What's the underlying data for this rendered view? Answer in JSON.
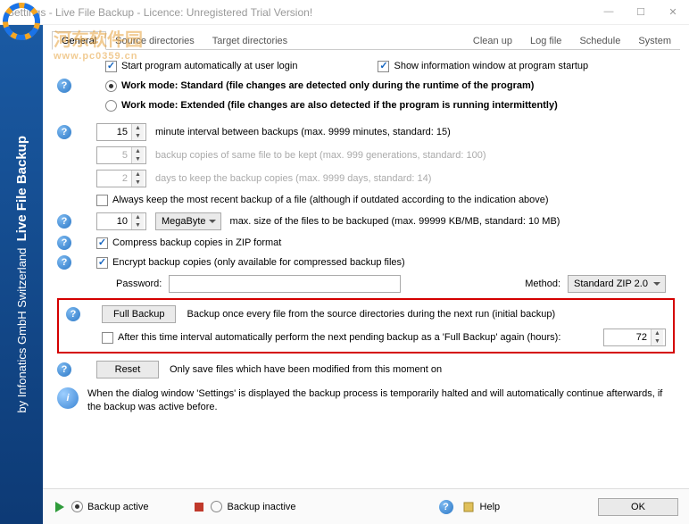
{
  "title": "Settings - Live File Backup - Licence: Unregistered Trial Version!",
  "watermark": {
    "main": "河东软件园",
    "sub": "www.pc0359.cn"
  },
  "sidebar": {
    "brand": "Live File Backup",
    "by": "by Infonatics GmbH Switzerland"
  },
  "tabs": {
    "left": [
      "General",
      "Source directories",
      "Target directories"
    ],
    "right": [
      "Clean up",
      "Log file",
      "Schedule",
      "System"
    ],
    "active": 0
  },
  "opts": {
    "autostart": "Start program automatically at user login",
    "showinfo": "Show information window at program startup",
    "wm_std": "Work mode: Standard (file changes are detected only during the runtime of the program)",
    "wm_ext": "Work mode: Extended (file changes are also detected if the program is running intermittently)"
  },
  "spins": {
    "interval": {
      "v": "15",
      "lbl": "minute interval between backups (max. 9999 minutes, standard: 15)"
    },
    "copies": {
      "v": "5",
      "lbl": "backup copies of same file to be kept (max. 999 generations, standard: 100)"
    },
    "days": {
      "v": "2",
      "lbl": "days to keep the backup copies (max. 9999 days, standard: 14)"
    },
    "always": "Always keep the most recent backup of a file (although if outdated according to the indication above)",
    "maxsize": {
      "v": "10",
      "unit": "MegaByte",
      "lbl": "max. size of the files to be backuped (max. 99999 KB/MB, standard: 10 MB)"
    }
  },
  "zip": {
    "compress": "Compress backup copies in ZIP format",
    "encrypt": "Encrypt backup copies (only available for compressed backup files)",
    "pwd_lbl": "Password:",
    "method_lbl": "Method:",
    "method_val": "Standard ZIP 2.0"
  },
  "full": {
    "btn": "Full Backup",
    "desc": "Backup once every file from the source directories during the next run (initial backup)",
    "auto": "After this time interval automatically perform the next pending backup as a 'Full Backup' again (hours):",
    "hours": "72"
  },
  "reset": {
    "btn": "Reset",
    "desc": "Only save files which have been modified from this moment on"
  },
  "info": "When the dialog window 'Settings' is displayed the backup process is temporarily halted and will automatically continue afterwards, if the backup was active before.",
  "footer": {
    "active": "Backup active",
    "inactive": "Backup inactive",
    "help": "Help",
    "ok": "OK"
  }
}
